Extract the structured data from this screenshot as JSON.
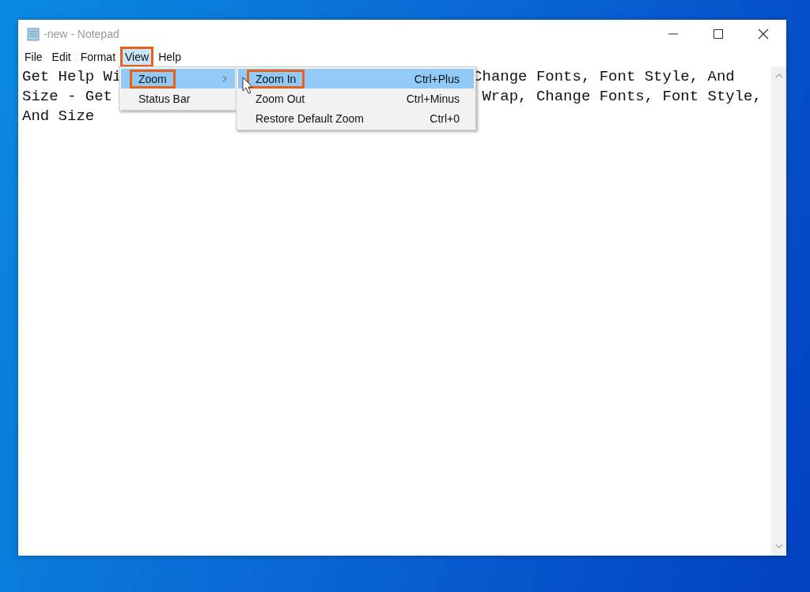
{
  "window": {
    "title": "-new - Notepad"
  },
  "menu_bar": [
    {
      "label": "File",
      "selected": false,
      "annotated": false
    },
    {
      "label": "Edit",
      "selected": false,
      "annotated": false
    },
    {
      "label": "Format",
      "selected": false,
      "annotated": false
    },
    {
      "label": "View",
      "selected": true,
      "annotated": true
    },
    {
      "label": "Help",
      "selected": false,
      "annotated": false
    }
  ],
  "view_menu": [
    {
      "label": "Zoom",
      "selected": true,
      "annotated": true,
      "submenu": true
    },
    {
      "label": "Status Bar",
      "selected": false,
      "annotated": false,
      "submenu": false
    }
  ],
  "zoom_submenu": [
    {
      "label": "Zoom In",
      "shortcut": "Ctrl+Plus",
      "selected": true,
      "annotated": true
    },
    {
      "label": "Zoom Out",
      "shortcut": "Ctrl+Minus",
      "selected": false,
      "annotated": false
    },
    {
      "label": "Restore Default Zoom",
      "shortcut": "Ctrl+0",
      "selected": false,
      "annotated": false
    }
  ],
  "document_lines": [
    {
      "left": "Get Help Wi",
      "right": "Change Fonts, Font Style, And"
    },
    {
      "left": "Size - Get",
      "right": "Wrap, Change Fonts, Font Style,"
    },
    {
      "left": "And Size"
    }
  ]
}
